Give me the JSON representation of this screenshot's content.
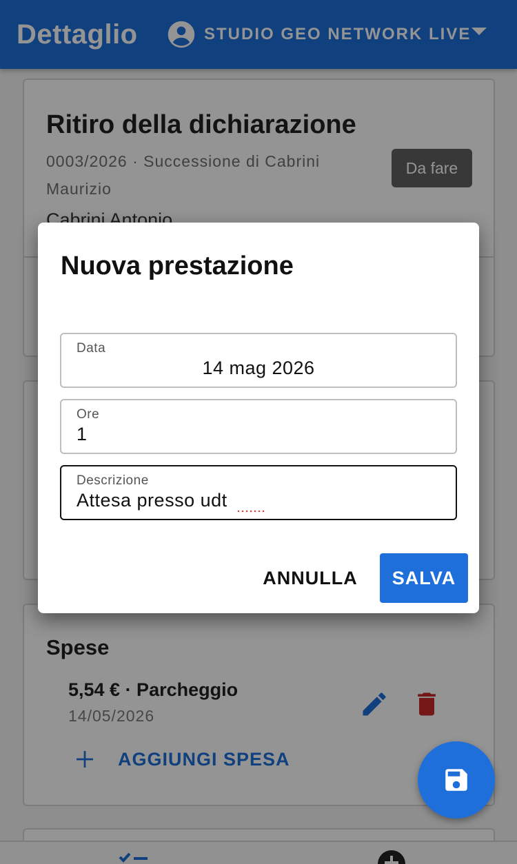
{
  "appbar": {
    "title": "Dettaglio",
    "account_name": "STUDIO GEO NETWORK LIVE",
    "account_icon": "account-circle-icon",
    "dropdown_icon": "caret-down-icon"
  },
  "task": {
    "title": "Ritiro della dichiarazione",
    "subtitle": "0003/2026 · Successione di Cabrini Maurizio",
    "person": "Cabrini Antonio",
    "status": "Da fare"
  },
  "expenses": {
    "heading": "Spese",
    "items": [
      {
        "amount_label": "5,54 € · Parcheggio",
        "date": "14/05/2026",
        "edit_icon": "pencil-icon",
        "delete_icon": "trash-icon"
      }
    ],
    "add_label": "AGGIUNGI SPESA",
    "add_icon": "plus-icon"
  },
  "fab": {
    "icon": "floppy-disk-icon"
  },
  "dialog": {
    "title": "Nuova prestazione",
    "fields": {
      "date": {
        "label": "Data",
        "value": "14 mag 2026"
      },
      "hours": {
        "label": "Ore",
        "value": "1"
      },
      "description": {
        "label": "Descrizione",
        "value": "Attesa presso udt"
      }
    },
    "cancel_label": "ANNULLA",
    "save_label": "SALVA"
  },
  "colors": {
    "primary": "#1e6fd9",
    "danger": "#c62828",
    "badge": "#616161"
  }
}
